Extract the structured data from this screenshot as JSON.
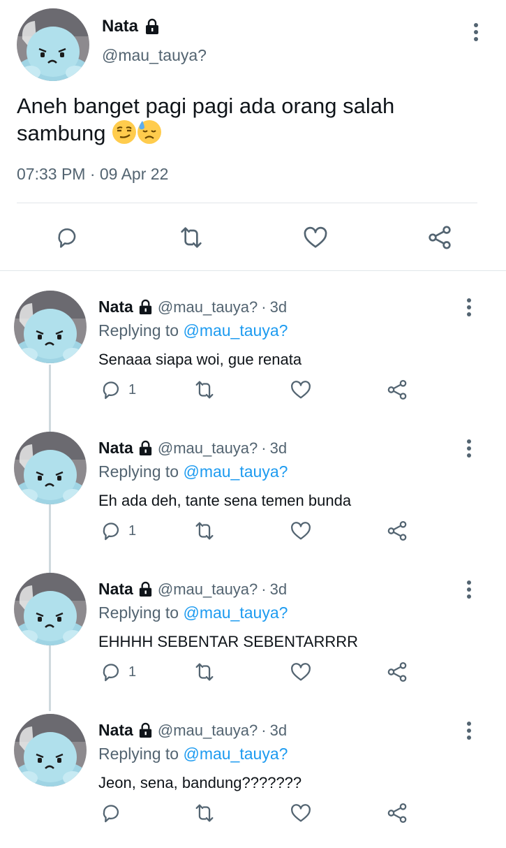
{
  "main_tweet": {
    "name": "Nata",
    "handle": "@mau_tauya?",
    "text": "Aneh banget pagi pagi ada orang salah sambung",
    "timestamp": "07:33 PM · 09 Apr 22",
    "icons": [
      "lock-icon",
      "more-icon",
      "reply-icon",
      "retweet-icon",
      "like-icon",
      "share-icon"
    ]
  },
  "replies": [
    {
      "name": "Nata",
      "handle": "@mau_tauya?",
      "separator": "·",
      "time": "3d",
      "replying_prefix": "Replying to",
      "replying_to": "@mau_tauya?",
      "text": "Senaaa siapa woi, gue renata",
      "reply_count": "1"
    },
    {
      "name": "Nata",
      "handle": "@mau_tauya?",
      "separator": "·",
      "time": "3d",
      "replying_prefix": "Replying to",
      "replying_to": "@mau_tauya?",
      "text": "Eh ada deh, tante sena temen bunda",
      "reply_count": "1"
    },
    {
      "name": "Nata",
      "handle": "@mau_tauya?",
      "separator": "·",
      "time": "3d",
      "replying_prefix": "Replying to",
      "replying_to": "@mau_tauya?",
      "text": "EHHHH SEBENTAR SEBENTARRRR",
      "reply_count": "1"
    },
    {
      "name": "Nata",
      "handle": "@mau_tauya?",
      "separator": "·",
      "time": "3d",
      "replying_prefix": "Replying to",
      "replying_to": "@mau_tauya?",
      "text": "Jeon, sena, bandung???????",
      "reply_count": ""
    }
  ],
  "colors": {
    "text": "#0f1419",
    "secondary": "#536471",
    "link": "#1d9bf0",
    "icon": "#536471",
    "divider": "#e1e6ea",
    "thread_line": "#cfd9de",
    "avatar_plush": "#a9dbe8"
  }
}
